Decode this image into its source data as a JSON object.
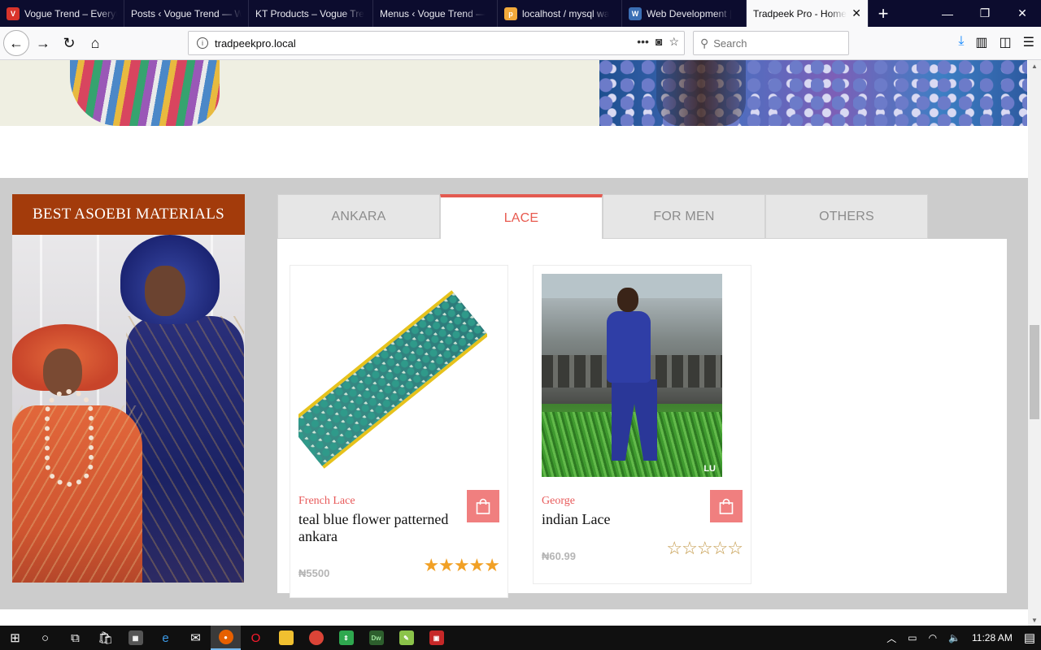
{
  "browser": {
    "tabs": [
      {
        "title": "Vogue Trend – Everyt",
        "icon": "vogue-favicon",
        "color": "#d9342b"
      },
      {
        "title": "Posts ‹ Vogue Trend — W",
        "icon": "wordpress-favicon",
        "color": "#0c0c2e"
      },
      {
        "title": "KT Products – Vogue Tre",
        "icon": "kt-favicon",
        "color": "#e8434f"
      },
      {
        "title": "Menus ‹ Vogue Trend — ",
        "icon": "wordpress-favicon",
        "color": "#0c0c2e"
      },
      {
        "title": "localhost / mysql wa",
        "icon": "phpmyadmin-favicon",
        "color": "#f2a93b"
      },
      {
        "title": "Web Development | ",
        "icon": "web-dev-favicon",
        "color": "#3b6fb5"
      },
      {
        "title": "Tradpeek Pro - Home",
        "icon": "none",
        "color": "#f9f9fa",
        "active": true
      }
    ],
    "url": "tradpeekpro.local",
    "search_placeholder": "Search"
  },
  "sidebar": {
    "heading": "BEST ASOEBI MATERIALS",
    "accent": "#a33b0b"
  },
  "product_tabs": [
    {
      "label": "ANKARA",
      "active": false
    },
    {
      "label": "LACE",
      "active": true
    },
    {
      "label": "FOR MEN",
      "active": false
    },
    {
      "label": "OTHERS",
      "active": false
    }
  ],
  "products": [
    {
      "category": "French Lace",
      "name": "teal blue flower patterned ankara",
      "price": "₦5500",
      "rating": 5,
      "stars": "★★★★★"
    },
    {
      "category": "George",
      "name": "indian Lace",
      "price": "₦60.99",
      "rating": 0,
      "stars": "☆☆☆☆☆",
      "photo_logo": "LU"
    }
  ],
  "colors": {
    "accent_red": "#e85a4f",
    "cart_button": "#f07f7f",
    "star_gold": "#f1a025",
    "section_gray": "#cccccc"
  },
  "taskbar": {
    "time": "11:28 AM"
  }
}
